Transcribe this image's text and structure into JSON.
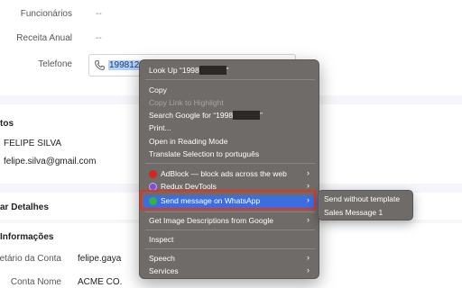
{
  "form": {
    "employees_label": "Funcionários",
    "employees_value": "--",
    "revenue_label": "Receita Anual",
    "revenue_value": "--",
    "phone_label": "Telefone",
    "phone_selected_text": "1998123"
  },
  "contact": {
    "heading": "tos",
    "name": "FELIPE SILVA",
    "email": "felipe.silva@gmail.com"
  },
  "details": {
    "heading": "ar Detalhes"
  },
  "info": {
    "heading": "Informações",
    "owner_label": "ietário da Conta",
    "owner_value": "felipe.gaya",
    "account_label": "Conta Nome",
    "account_value": "ACME CO."
  },
  "context_menu": {
    "look_up": "Look Up “1998",
    "look_up_end": "”",
    "copy": "Copy",
    "copy_link": "Copy Link to Highlight",
    "search_google": "Search Google for “1998",
    "search_google_end": "”",
    "print": "Print...",
    "reading_mode": "Open in Reading Mode",
    "translate": "Translate Selection to português",
    "adblock": "AdBlock — block ads across the web",
    "redux": "Redux DevTools",
    "whatsapp": "Send message on WhatsApp",
    "image_descriptions": "Get Image Descriptions from Google",
    "inspect": "Inspect",
    "speech": "Speech",
    "services": "Services",
    "chevron": "›"
  },
  "submenu": {
    "send_without_template": "Send without template",
    "sales_message": "Sales Message 1"
  },
  "colors": {
    "menu_bg": "#6f6b68",
    "highlight": "#3c6ee0",
    "red_frame": "#e6331e",
    "selection": "#b5d2f7"
  },
  "icons": [
    "phone-icon",
    "adblock-icon",
    "redux-icon",
    "whatsapp-icon",
    "chevron-right-icon"
  ]
}
